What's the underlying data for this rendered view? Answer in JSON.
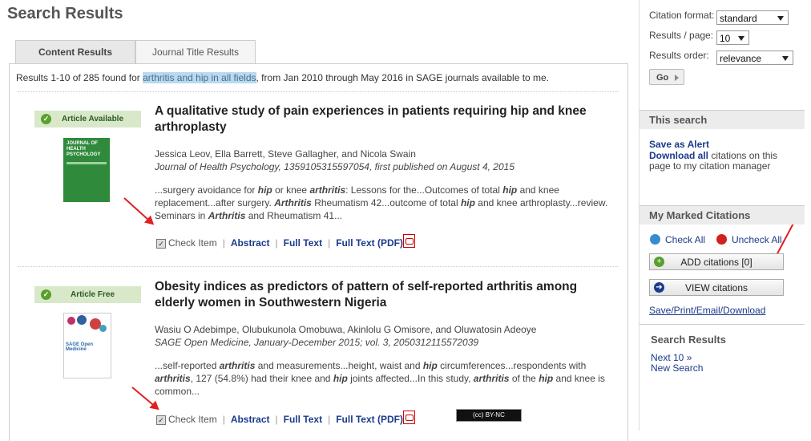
{
  "page": {
    "title": "Search Results"
  },
  "tabs": [
    {
      "label": "Content Results",
      "active": true
    },
    {
      "label": "Journal Title Results",
      "active": false
    }
  ],
  "summary": {
    "prefix": "Results 1-10 of 285 found for ",
    "query": "arthritis and hip in all fields",
    "suffix": ", from Jan 2010 through May 2016 in SAGE journals available to me."
  },
  "results": [
    {
      "badge": "Article Available",
      "title": "A qualitative study of pain experiences in patients requiring hip and knee arthroplasty",
      "authors": "Jessica Leov, Ella Barrett, Steve Gallagher, and Nicola Swain",
      "journal": "Journal of Health Psychology, 1359105315597054, first published on August 4, 2015",
      "cover_text": "JOURNAL OF HEALTH PSYCHOLOGY",
      "snippet_parts": [
        {
          "t": "...surgery avoidance for ",
          "b": false
        },
        {
          "t": "hip",
          "b": true
        },
        {
          "t": " or knee ",
          "b": false
        },
        {
          "t": "arthritis",
          "b": true
        },
        {
          "t": ": Lessons for the...Outcomes of total ",
          "b": false
        },
        {
          "t": "hip",
          "b": true
        },
        {
          "t": " and knee replacement...after surgery. ",
          "b": false
        },
        {
          "t": "Arthritis",
          "b": true
        },
        {
          "t": " Rheumatism 42...outcome of total ",
          "b": false
        },
        {
          "t": "hip",
          "b": true
        },
        {
          "t": " and knee arthroplasty...review. Seminars in ",
          "b": false
        },
        {
          "t": "Arthritis",
          "b": true
        },
        {
          "t": " and Rheumatism 41...",
          "b": false
        }
      ],
      "check_label": "Check Item",
      "abstract": "Abstract",
      "full_text": "Full Text",
      "full_text_pdf": "Full Text (PDF)"
    },
    {
      "badge": "Article Free",
      "title": "Obesity indices as predictors of pattern of self-reported arthritis among elderly women in Southwestern Nigeria",
      "authors": "Wasiu O Adebimpe, Olubukunola Omobuwa, Akinlolu G Omisore, and Oluwatosin Adeoye",
      "journal": "SAGE Open Medicine, January-December 2015; vol. 3, 2050312115572039",
      "cover_text": "SAGE Open Medicine",
      "snippet_parts": [
        {
          "t": "...self-reported ",
          "b": false
        },
        {
          "t": "arthritis",
          "b": true
        },
        {
          "t": " and measurements...height, waist and ",
          "b": false
        },
        {
          "t": "hip",
          "b": true
        },
        {
          "t": " circumferences...respondents with ",
          "b": false
        },
        {
          "t": "arthritis",
          "b": true
        },
        {
          "t": ", 127 (54.8%) had their knee and ",
          "b": false
        },
        {
          "t": "hip",
          "b": true
        },
        {
          "t": " joints affected...In this study, ",
          "b": false
        },
        {
          "t": "arthritis",
          "b": true
        },
        {
          "t": " of the ",
          "b": false
        },
        {
          "t": "hip",
          "b": true
        },
        {
          "t": " and knee is common...",
          "b": false
        }
      ],
      "check_label": "Check Item",
      "abstract": "Abstract",
      "full_text": "Full Text",
      "full_text_pdf": "Full Text (PDF)",
      "license": "BY-NC"
    }
  ],
  "options": {
    "citation_format_label": "Citation format:",
    "citation_format_value": "standard",
    "results_per_page_label": "Results / page:",
    "results_per_page_value": "10",
    "results_order_label": "Results order:",
    "results_order_value": "relevance",
    "go_label": "Go"
  },
  "this_search": {
    "heading": "This search",
    "save_alert": "Save as Alert",
    "download_all": "Download all",
    "download_rest": " citations on this page to my citation manager"
  },
  "marked": {
    "heading": "My Marked Citations",
    "check_all": "Check All",
    "uncheck_all": "Uncheck All",
    "add_label": "ADD citations [0]",
    "view_label": "VIEW citations",
    "save_print": "Save/Print/Email/Download"
  },
  "search_results_box": {
    "heading": "Search Results",
    "next": "Next 10 »",
    "new_search": "New Search"
  },
  "colors": {
    "badge_bg": "#d8e8c8",
    "link": "#1a3a8a",
    "highlight": "#b8d9f0",
    "arrow": "#e02020"
  }
}
